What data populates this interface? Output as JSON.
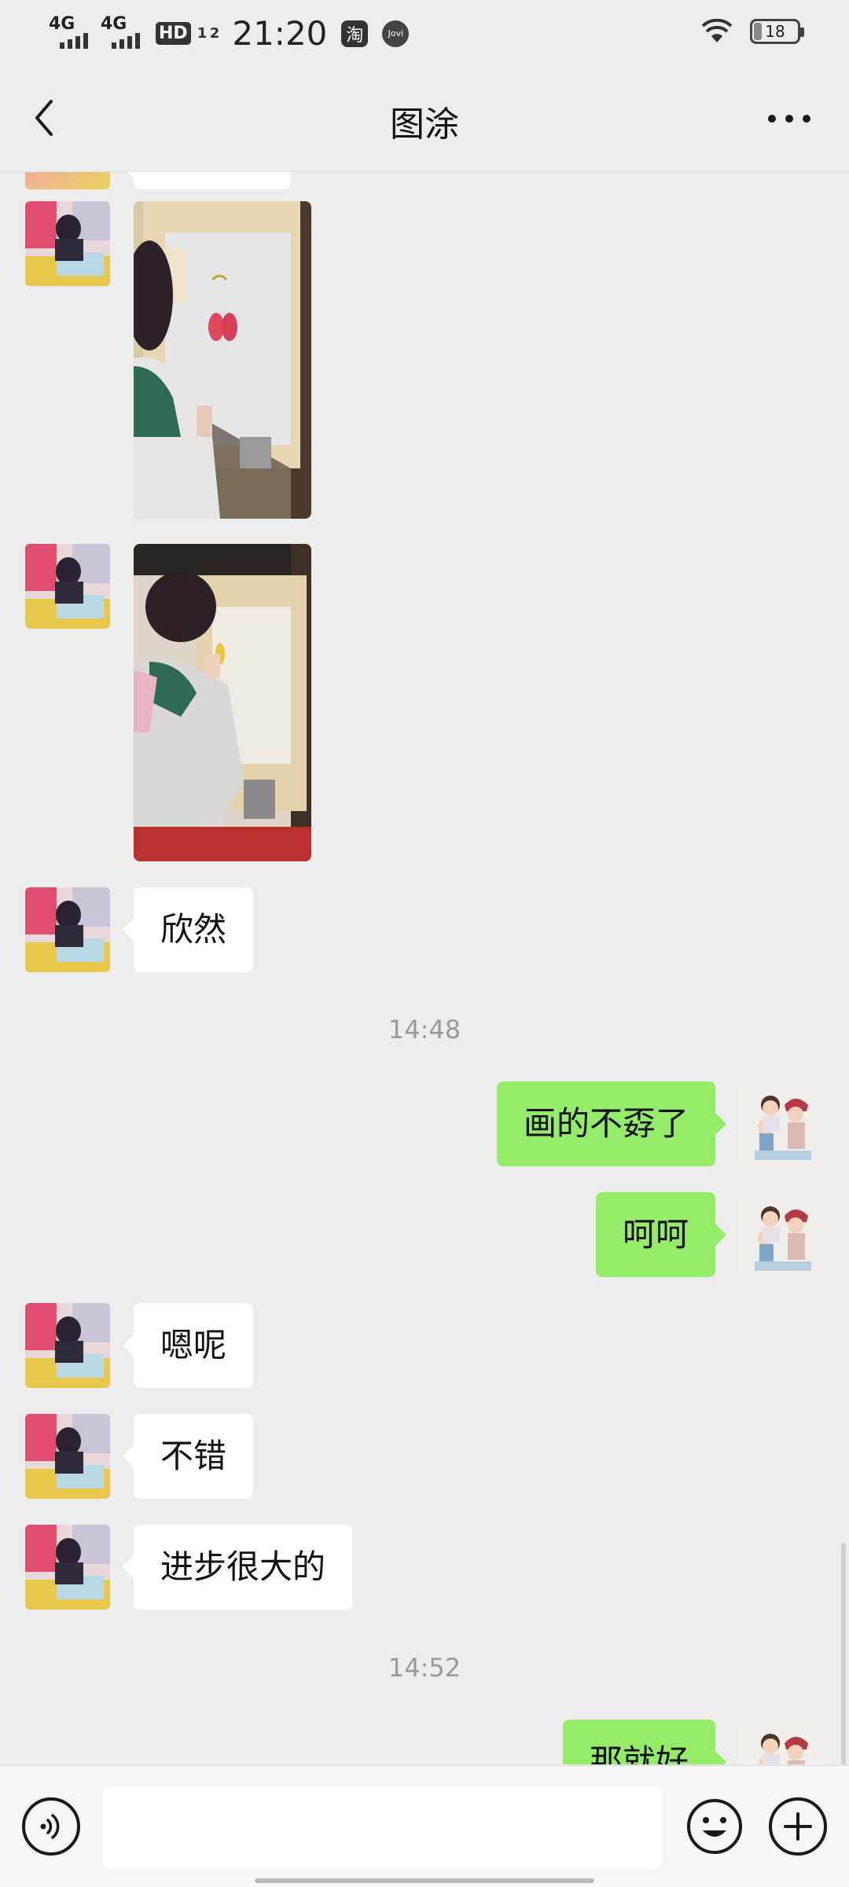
{
  "status_bar": {
    "network_1": "4G",
    "network_2": "4G",
    "hd_badge": "HD",
    "hd_sub": "1 2",
    "time": "21:20",
    "app_badge": "淘",
    "jovi_badge": "Jovi",
    "battery_level": "18"
  },
  "header": {
    "title": "图涂"
  },
  "messages": [
    {
      "type": "image",
      "sender": "other",
      "description_icon": "photo-child-painting-1"
    },
    {
      "type": "image",
      "sender": "other",
      "description_icon": "photo-child-painting-2"
    },
    {
      "type": "text",
      "sender": "other",
      "text": "欣然"
    },
    {
      "type": "timestamp",
      "text": "14:48"
    },
    {
      "type": "text",
      "sender": "me",
      "text": "画的不孬了"
    },
    {
      "type": "text",
      "sender": "me",
      "text": "呵呵"
    },
    {
      "type": "text",
      "sender": "other",
      "text": "嗯呢"
    },
    {
      "type": "text",
      "sender": "other",
      "text": "不错"
    },
    {
      "type": "text",
      "sender": "other",
      "text": "进步很大的"
    },
    {
      "type": "timestamp",
      "text": "14:52"
    },
    {
      "type": "text",
      "sender": "me",
      "text": "那就好"
    }
  ],
  "input": {
    "value": "",
    "placeholder": ""
  },
  "colors": {
    "background": "#ededed",
    "outgoing_bubble": "#95ec69",
    "incoming_bubble": "#ffffff",
    "timestamp_text": "#9a9a9a"
  }
}
